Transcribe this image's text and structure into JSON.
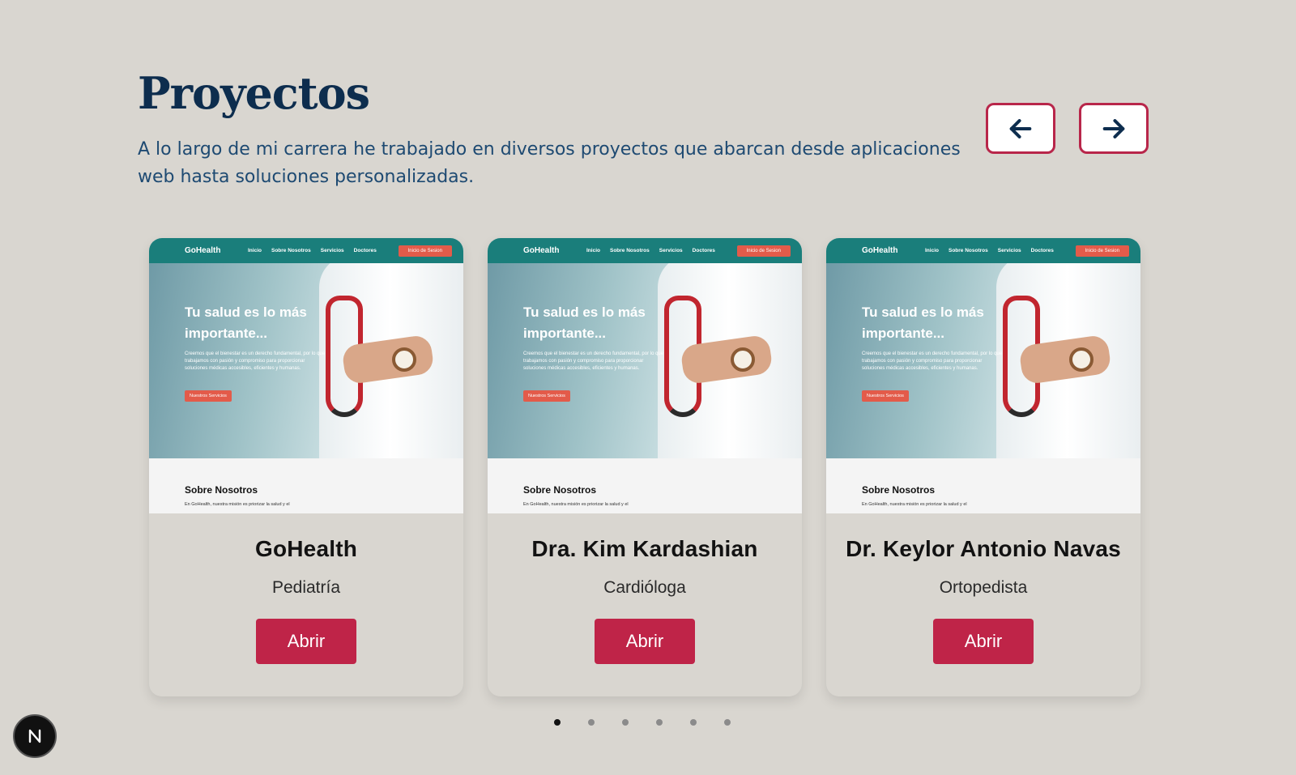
{
  "header": {
    "title": "Proyectos",
    "description": "A lo largo de mi carrera he trabajado en diversos proyectos que abarcan desde aplicaciones web hasta soluciones personalizadas."
  },
  "navigation": {
    "prev_icon": "arrow-left-icon",
    "next_icon": "arrow-right-icon",
    "border_color": "#b8264a",
    "arrow_color": "#0d2d4e"
  },
  "cards": [
    {
      "name": "GoHealth",
      "role": "Pediatría",
      "button_label": "Abrir",
      "preview": {
        "logo": "GoHealth",
        "nav_links": [
          "Inicio",
          "Sobre Nosotros",
          "Servicios",
          "Doctores"
        ],
        "cta": "Inicio de Sesion",
        "hero_title": "Tu salud es lo más importante...",
        "hero_body": "Creemos que el bienestar es un derecho fundamental, por lo que trabajamos con pasión y compromiso para proporcionar soluciones médicas accesibles, eficientes y humanas.",
        "hero_button": "Nuestros Servicios",
        "about_title": "Sobre Nosotros",
        "about_text": "En GoHealth, nuestra misión es priorizar la salud y el"
      }
    },
    {
      "name": "Dra. Kim Kardashian",
      "role": "Cardióloga",
      "button_label": "Abrir",
      "preview": {
        "logo": "GoHealth",
        "nav_links": [
          "Inicio",
          "Sobre Nosotros",
          "Servicios",
          "Doctores"
        ],
        "cta": "Inicio de Sesion",
        "hero_title": "Tu salud es lo más importante...",
        "hero_body": "Creemos que el bienestar es un derecho fundamental, por lo que trabajamos con pasión y compromiso para proporcionar soluciones médicas accesibles, eficientes y humanas.",
        "hero_button": "Nuestros Servicios",
        "about_title": "Sobre Nosotros",
        "about_text": "En GoHealth, nuestra misión es priorizar la salud y el"
      }
    },
    {
      "name": "Dr. Keylor Antonio Navas",
      "role": "Ortopedista",
      "button_label": "Abrir",
      "preview": {
        "logo": "GoHealth",
        "nav_links": [
          "Inicio",
          "Sobre Nosotros",
          "Servicios",
          "Doctores"
        ],
        "cta": "Inicio de Sesion",
        "hero_title": "Tu salud es lo más importante...",
        "hero_body": "Creemos que el bienestar es un derecho fundamental, por lo que trabajamos con pasión y compromiso para proporcionar soluciones médicas accesibles, eficientes y humanas.",
        "hero_button": "Nuestros Servicios",
        "about_title": "Sobre Nosotros",
        "about_text": "En GoHealth, nuestra misión es priorizar la salud y el"
      }
    }
  ],
  "pagination": {
    "total": 6,
    "active": 0
  },
  "badge": {
    "letter": "N",
    "icon": "nextjs-logo-icon"
  },
  "colors": {
    "background": "#d9d6d0",
    "title": "#0d2d4e",
    "description": "#1e4a72",
    "button": "#bf2448",
    "preview_nav": "#1a7e7b",
    "preview_cta": "#e35b4a"
  }
}
